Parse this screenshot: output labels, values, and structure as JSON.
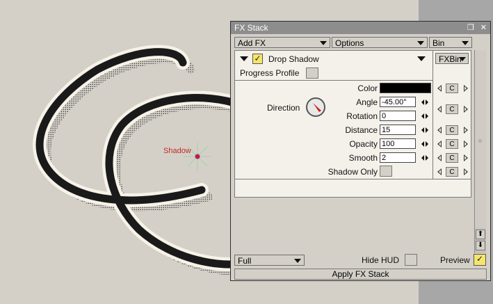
{
  "canvas": {
    "shadow_label": "Shadow"
  },
  "panel": {
    "title": "FX Stack",
    "icons": [
      "restore-icon",
      "close-icon"
    ],
    "menus": {
      "add_fx": "Add FX",
      "options": "Options",
      "bin": "Bin"
    },
    "effect": {
      "name": "Drop Shadow",
      "enabled": true,
      "progress_profile_label": "Progress Profile",
      "fxbin_label": "FXBin"
    },
    "direction_label": "Direction",
    "params": {
      "color": {
        "label": "Color",
        "value": "#000000"
      },
      "angle": {
        "label": "Angle",
        "value": "-45.00°"
      },
      "rotation": {
        "label": "Rotation",
        "value": "0"
      },
      "distance": {
        "label": "Distance",
        "value": "15"
      },
      "opacity": {
        "label": "Opacity",
        "value": "100"
      },
      "smooth": {
        "label": "Smooth",
        "value": "2"
      },
      "shadow_only": {
        "label": "Shadow Only",
        "checked": false
      }
    },
    "keyframe_button_label": "C",
    "bottom": {
      "quality": "Full",
      "hide_hud_label": "Hide HUD",
      "preview_label": "Preview",
      "preview_checked": true,
      "apply_label": "Apply FX Stack"
    },
    "colors": {
      "accent_check": "#f5e56a",
      "dial_needle": "#cc1f1f",
      "title_bar": "#8d8d8d"
    }
  }
}
